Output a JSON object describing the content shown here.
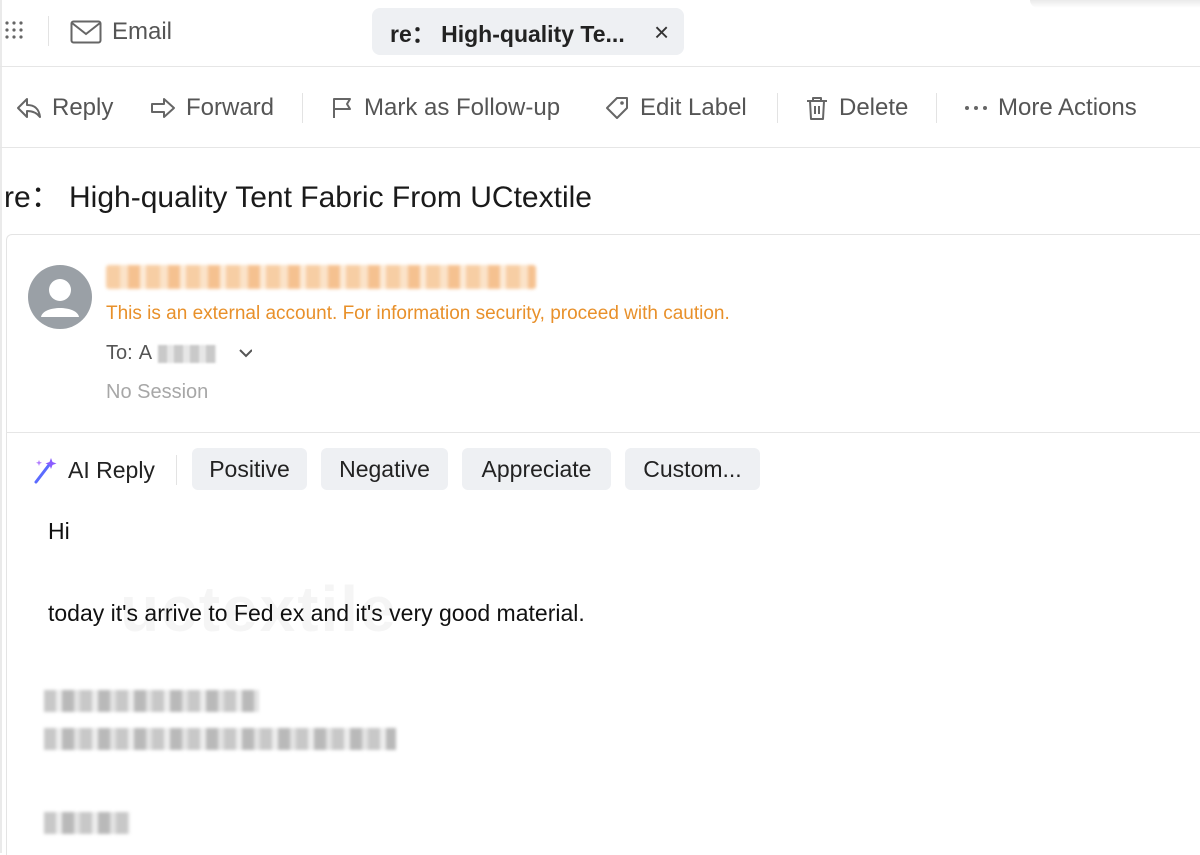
{
  "tabs": {
    "email_label": "Email",
    "active_label": "re： High-quality Te...",
    "close_glyph": "×"
  },
  "toolbar": {
    "reply": "Reply",
    "forward": "Forward",
    "follow_up": "Mark as Follow-up",
    "edit_label": "Edit Label",
    "delete": "Delete",
    "more": "More Actions"
  },
  "message": {
    "subject": "re： High-quality Tent Fabric From UCtextile",
    "external_warning": "This is an external account. For information security, proceed with caution.",
    "to_label": "To:",
    "to_initial": "A",
    "session": "No Session"
  },
  "ai_reply": {
    "label": "AI Reply",
    "options": [
      "Positive",
      "Negative",
      "Appreciate",
      "Custom..."
    ]
  },
  "body": {
    "greeting": "Hi",
    "line1": "today it's arrive to Fed ex and it's very good material.",
    "watermark": "uctextile"
  },
  "icons": [
    "apps-grid-icon",
    "mail-icon",
    "close-icon",
    "reply-icon",
    "forward-icon",
    "flag-icon",
    "tag-icon",
    "trash-icon",
    "more-dots-icon",
    "user-avatar-icon",
    "chevron-down-icon",
    "sparkle-icon"
  ],
  "colors": {
    "warning": "#e8902a",
    "chip_bg": "#eef0f3",
    "ai_sparkle": "#6a5cff"
  }
}
